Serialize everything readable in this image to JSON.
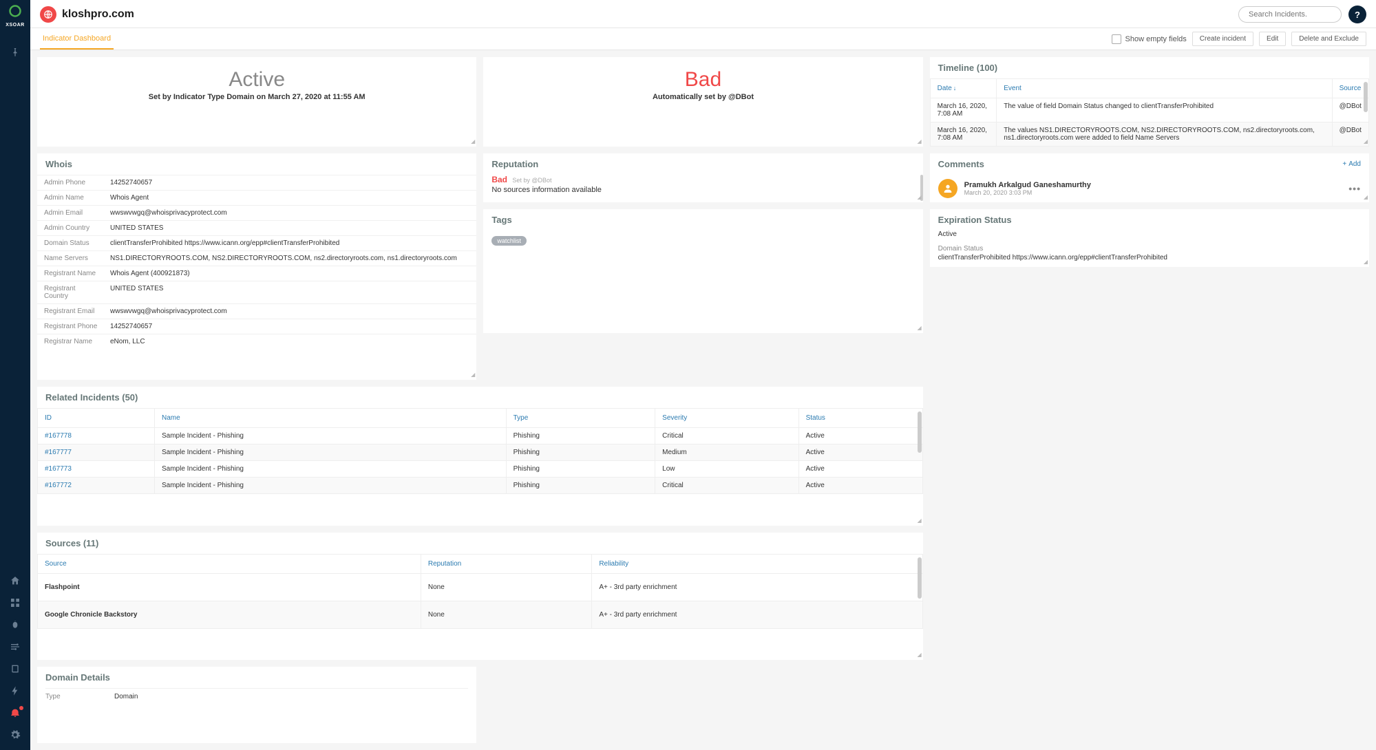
{
  "app": {
    "brand": "XSOAR",
    "page_title": "kloshpro.com",
    "search_placeholder": "Search Incidents.",
    "help": "?",
    "tab": "Indicator Dashboard",
    "show_empty_fields": "Show empty fields",
    "buttons": {
      "create_incident": "Create incident",
      "edit": "Edit",
      "delete_exclude": "Delete and Exclude"
    }
  },
  "status_left": {
    "title": "Active",
    "subtitle": "Set by Indicator Type Domain on March 27, 2020 at 11:55 AM"
  },
  "status_right": {
    "title": "Bad",
    "subtitle": "Automatically set by @DBot"
  },
  "whois": {
    "header": "Whois",
    "rows": [
      {
        "label": "Admin Phone",
        "value": "14252740657"
      },
      {
        "label": "Admin Name",
        "value": "Whois Agent"
      },
      {
        "label": "Admin Email",
        "value": "wwswvwgq@whoisprivacyprotect.com"
      },
      {
        "label": "Admin Country",
        "value": "UNITED STATES"
      },
      {
        "label": "Domain Status",
        "value": "clientTransferProhibited https://www.icann.org/epp#clientTransferProhibited"
      },
      {
        "label": "Name Servers",
        "value": "NS1.DIRECTORYROOTS.COM, NS2.DIRECTORYROOTS.COM, ns2.directoryroots.com, ns1.directoryroots.com"
      },
      {
        "label": "Registrant Name",
        "value": "Whois Agent (400921873)"
      },
      {
        "label": "Registrant Country",
        "value": "UNITED STATES"
      },
      {
        "label": "Registrant Email",
        "value": "wwswvwgq@whoisprivacyprotect.com"
      },
      {
        "label": "Registrant Phone",
        "value": "14252740657"
      },
      {
        "label": "Registrar Name",
        "value": "eNom, LLC"
      }
    ]
  },
  "reputation": {
    "header": "Reputation",
    "verdict": "Bad",
    "setby": "Set by @DBot",
    "text": "No sources information available"
  },
  "tags": {
    "header": "Tags",
    "items": [
      "watchlist"
    ]
  },
  "related_incidents": {
    "header": "Related Incidents (50)",
    "columns": [
      "ID",
      "Name",
      "Type",
      "Severity",
      "Status"
    ],
    "rows": [
      {
        "id": "#167778",
        "name": "Sample Incident - Phishing",
        "type": "Phishing",
        "severity": "Critical",
        "status": "Active"
      },
      {
        "id": "#167777",
        "name": "Sample Incident - Phishing",
        "type": "Phishing",
        "severity": "Medium",
        "status": "Active"
      },
      {
        "id": "#167773",
        "name": "Sample Incident - Phishing",
        "type": "Phishing",
        "severity": "Low",
        "status": "Active"
      },
      {
        "id": "#167772",
        "name": "Sample Incident - Phishing",
        "type": "Phishing",
        "severity": "Critical",
        "status": "Active"
      }
    ]
  },
  "sources": {
    "header": "Sources (11)",
    "columns": [
      "Source",
      "Reputation",
      "Reliability"
    ],
    "rows": [
      {
        "source": "Flashpoint",
        "reputation": "None",
        "reliability": "A+ - 3rd party enrichment"
      },
      {
        "source": "Google Chronicle Backstory",
        "reputation": "None",
        "reliability": "A+ - 3rd party enrichment"
      }
    ]
  },
  "domain_details": {
    "header": "Domain Details",
    "rows": [
      {
        "label": "Type",
        "value": "Domain"
      }
    ]
  },
  "timeline": {
    "header": "Timeline (100)",
    "columns": [
      "Date",
      "Event",
      "Source"
    ],
    "rows": [
      {
        "date": "March 16, 2020, 7:08 AM",
        "event": "The value of field Domain Status changed to clientTransferProhibited",
        "source": "@DBot"
      },
      {
        "date": "March 16, 2020, 7:08 AM",
        "event": "The values NS1.DIRECTORYROOTS.COM, NS2.DIRECTORYROOTS.COM, ns2.directoryroots.com, ns1.directoryroots.com were added to field Name Servers",
        "source": "@DBot"
      }
    ]
  },
  "comments": {
    "header": "Comments",
    "add": "Add",
    "items": [
      {
        "name": "Pramukh Arkalgud Ganeshamurthy",
        "date": "March 20, 2020 3:03 PM"
      }
    ]
  },
  "expiration": {
    "header": "Expiration Status",
    "status_value": "Active",
    "domain_status_label": "Domain Status",
    "domain_status_value": "clientTransferProhibited https://www.icann.org/epp#clientTransferProhibited"
  }
}
